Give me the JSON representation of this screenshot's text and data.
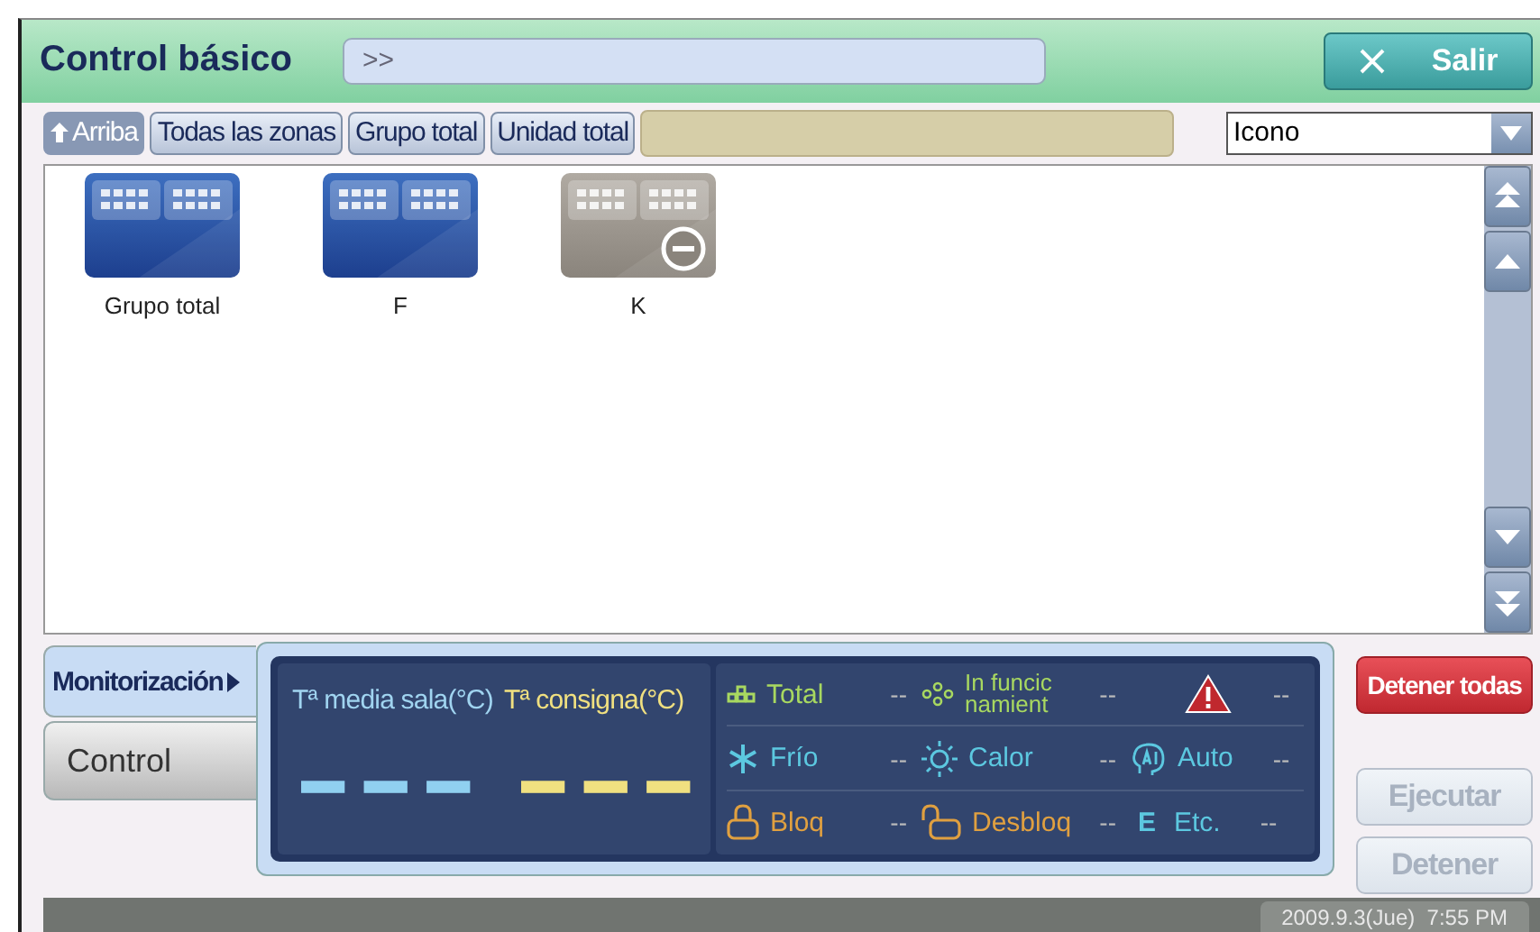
{
  "header": {
    "title": "Control básico",
    "path": ">>",
    "exit_button": "Salir"
  },
  "toolbar": {
    "buttons": [
      {
        "label": "Arriba",
        "kind": "up",
        "disabled": true
      },
      {
        "label": "Todas las zonas",
        "kind": "plain",
        "disabled": false
      },
      {
        "label": "Grupo total",
        "kind": "plain",
        "disabled": false
      },
      {
        "label": "Unidad total",
        "kind": "plain",
        "disabled": false
      }
    ],
    "view_select": "Icono"
  },
  "groups": [
    {
      "label": "Grupo total",
      "disabled": false
    },
    {
      "label": "F",
      "disabled": false
    },
    {
      "label": "K",
      "disabled": true
    }
  ],
  "mode_tabs": [
    {
      "label": "Monitorización",
      "selected": true
    },
    {
      "label": "Control",
      "selected": false
    }
  ],
  "monitor": {
    "avg_temp_label": "Tª media sala(°C)",
    "set_temp_label": "Tª consigna(°C)",
    "stats": [
      {
        "kind": "total",
        "label": "Total",
        "value": "--",
        "color": "#a8d860"
      },
      {
        "kind": "running",
        "label": "In funcic namient",
        "value": "--",
        "color": "#a8d860"
      },
      {
        "kind": "alarm",
        "value": "--",
        "color": "#c0282e"
      },
      {
        "kind": "cold",
        "label": "Frío",
        "value": "--",
        "color": "#5cc8e0"
      },
      {
        "kind": "heat",
        "label": "Calor",
        "value": "--",
        "color": "#5cc8e0"
      },
      {
        "kind": "auto",
        "label": "Auto",
        "value": "--",
        "color": "#5cc8e0"
      },
      {
        "kind": "lock",
        "label": "Bloq",
        "value": "--",
        "color": "#e0a040"
      },
      {
        "kind": "unlock",
        "label": "Desbloq",
        "value": "--",
        "color": "#e0a040"
      },
      {
        "kind": "etc",
        "symbol": "E",
        "label": "Etc.",
        "value": "--",
        "color": "#5cc8e0"
      }
    ]
  },
  "actions": [
    {
      "label": "Detener todas",
      "kind": "danger",
      "disabled": false
    },
    {
      "label": "Ejecutar",
      "kind": "normal",
      "disabled": true
    },
    {
      "label": "Detener",
      "kind": "normal",
      "disabled": true
    }
  ],
  "status_bar": {
    "datetime": "2009.9.3(Jue)  7:55 PM"
  }
}
